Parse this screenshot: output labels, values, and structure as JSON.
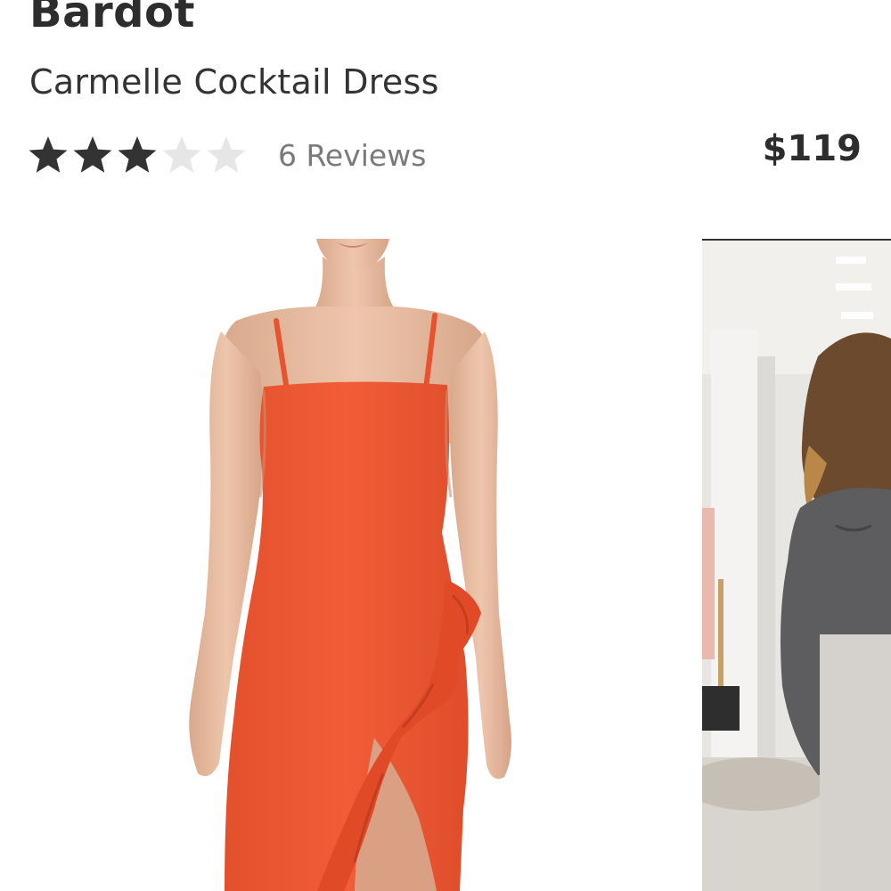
{
  "product": {
    "brand": "Bardot",
    "name": "Carmelle Cocktail Dress",
    "rating": 3,
    "rating_max": 5,
    "reviews_label": "6 Reviews",
    "price": "$119"
  },
  "gallery": {
    "images": [
      {
        "name": "orange-dress-photo"
      },
      {
        "name": "store-model-photo"
      }
    ]
  },
  "colors": {
    "star_filled": "#333333",
    "star_empty": "#e6e6e6",
    "dress": "#ef5a35"
  }
}
